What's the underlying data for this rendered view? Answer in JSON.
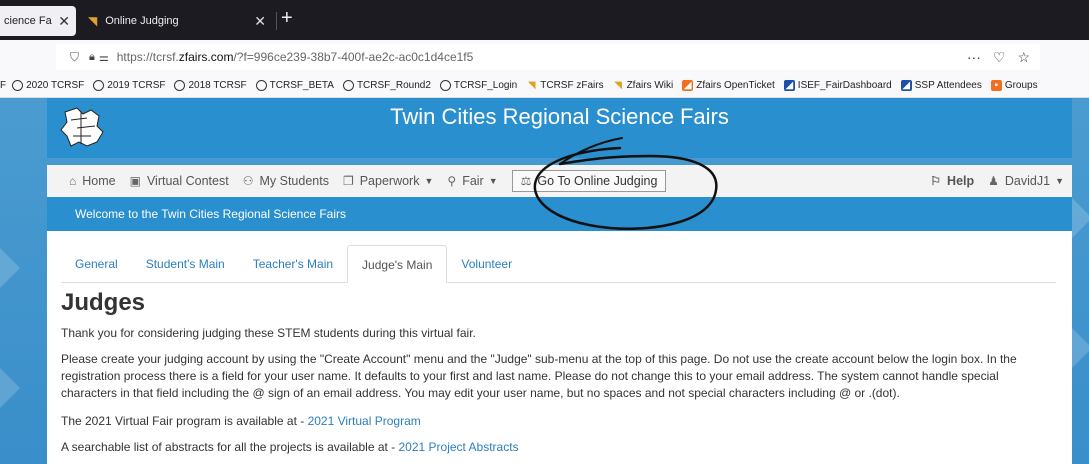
{
  "browser": {
    "tabs": [
      {
        "title": "cience Fa",
        "close": "✕"
      },
      {
        "title": "Online Judging",
        "close": "✕"
      }
    ],
    "new_tab": "+",
    "url_prefix": "https://tcrsf.",
    "url_domain": "zfairs.com",
    "url_suffix": "/?f=996ce239-38b7-400f-ae2c-ac0c1d4ce1f5",
    "url_more": "···",
    "bookmarks": [
      {
        "label": "2020 TCRSF",
        "icon": "globe-icon"
      },
      {
        "label": "2019 TCRSF",
        "icon": "globe-icon"
      },
      {
        "label": "2018 TCRSF",
        "icon": "globe-icon"
      },
      {
        "label": "TCRSF_BETA",
        "icon": "globe-icon"
      },
      {
        "label": "TCRSF_Round2",
        "icon": "globe-icon"
      },
      {
        "label": "TCRSF_Login",
        "icon": "globe-icon"
      },
      {
        "label": "TCRSF zFairs",
        "icon": "zfairs-icon"
      },
      {
        "label": "Zfairs Wiki",
        "icon": "zfairs-icon"
      },
      {
        "label": "Zfairs OpenTicket",
        "icon": "ticket-icon"
      },
      {
        "label": "ISEF_FairDashboard",
        "icon": "isef-icon"
      },
      {
        "label": "SSP Attendees",
        "icon": "isef-icon"
      },
      {
        "label": "Groups",
        "icon": "groups-icon"
      }
    ],
    "bookmark_lead": "F"
  },
  "site": {
    "title": "Twin Cities Regional Science Fairs",
    "welcome": "Welcome to the Twin Cities Regional Science Fairs"
  },
  "nav": {
    "home": "Home",
    "virtual_contest": "Virtual Contest",
    "my_students": "My Students",
    "paperwork": "Paperwork",
    "fair": "Fair",
    "online_judging": "Go To Online Judging",
    "help": "Help",
    "user": "DavidJ1"
  },
  "tabs": [
    "General",
    "Student's Main",
    "Teacher's Main",
    "Judge's Main",
    "Volunteer"
  ],
  "active_tab": "Judge's Main",
  "content": {
    "heading": "Judges",
    "p1": "Thank you for considering judging these STEM students during this virtual fair.",
    "p2": "Please create your judging account by using the \"Create Account\" menu and the \"Judge\" sub-menu at the top of this page.  Do not use the create account below the login box.  In the registration process there is a field for your user name.  It defaults to your first and last name.  Please do not change this to your email address.  The system cannot handle special characters in that field including the @ sign of an email address. You may edit your user name, but no spaces and not special characters including @ or .(dot).",
    "p3_text": "The 2021 Virtual Fair program is available at - ",
    "p3_link": "2021 Virtual Program",
    "p4_text": "A searchable list of abstracts for all the projects is available at - ",
    "p4_link": "2021 Project Abstracts"
  },
  "colors": {
    "brand_blue": "#2a8fcf",
    "link_blue": "#2a7fc0"
  }
}
